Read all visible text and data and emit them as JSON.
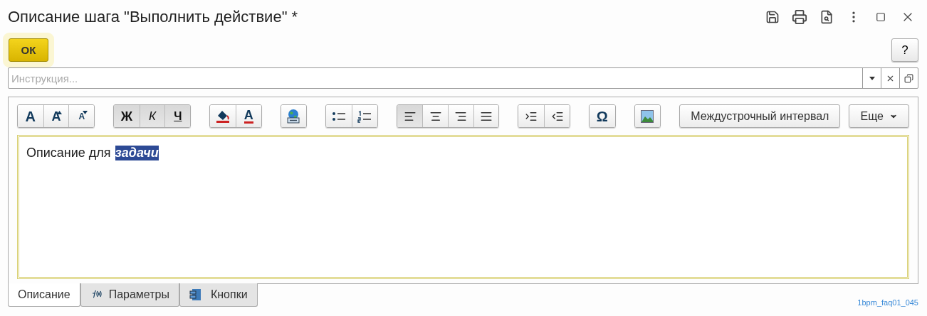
{
  "window": {
    "title": "Описание шага \"Выполнить действие\" *"
  },
  "ok_button": {
    "label": "ОК"
  },
  "help_button": {
    "label": "?"
  },
  "instruction_field": {
    "placeholder": "Инструкция..."
  },
  "toolbar": [
    {
      "items": [
        {
          "kind": "letter",
          "label": "A",
          "pressed": false
        },
        {
          "kind": "grow",
          "label": "A",
          "pressed": false
        },
        {
          "kind": "shrink",
          "label": "A",
          "pressed": false
        }
      ]
    },
    {
      "items": [
        {
          "kind": "bold",
          "label": "Ж",
          "pressed": true
        },
        {
          "kind": "italic",
          "label": "К",
          "pressed": true
        },
        {
          "kind": "underline",
          "label": "Ч",
          "pressed": true
        }
      ]
    },
    {
      "items": [
        {
          "kind": "fill-color",
          "pressed": false
        },
        {
          "kind": "font-color",
          "label": "A",
          "pressed": false
        }
      ]
    },
    {
      "items": [
        {
          "kind": "hyperlink",
          "pressed": false
        }
      ]
    },
    {
      "items": [
        {
          "kind": "bullets",
          "pressed": false
        },
        {
          "kind": "numbering",
          "pressed": false
        }
      ]
    },
    {
      "items": [
        {
          "kind": "align-left",
          "pressed": true
        },
        {
          "kind": "align-center",
          "pressed": false
        },
        {
          "kind": "align-right",
          "pressed": false
        },
        {
          "kind": "align-justify",
          "pressed": false
        }
      ]
    },
    {
      "items": [
        {
          "kind": "indent",
          "pressed": false
        },
        {
          "kind": "outdent",
          "pressed": false
        }
      ]
    },
    {
      "items": [
        {
          "kind": "letter",
          "label": "Ω",
          "pressed": false
        }
      ]
    },
    {
      "items": [
        {
          "kind": "image",
          "pressed": false
        }
      ]
    },
    {
      "items": [
        {
          "kind": "text",
          "label": "Междустрочный интервал",
          "pressed": false
        }
      ]
    },
    {
      "items": [
        {
          "kind": "menu",
          "label": "Еще",
          "pressed": false
        }
      ]
    }
  ],
  "editor": {
    "content": [
      {
        "text": "Описание для",
        "selected": false
      },
      {
        "text": "задачи",
        "selected": true
      }
    ]
  },
  "tabs": [
    {
      "label": "Описание",
      "selected": true,
      "kind": "plain"
    },
    {
      "label": "Параметры",
      "selected": false,
      "kind": "formula"
    },
    {
      "label": "Кнопки",
      "selected": false,
      "kind": "buttons"
    }
  ],
  "footer_code": "1bpm_faq01_045"
}
